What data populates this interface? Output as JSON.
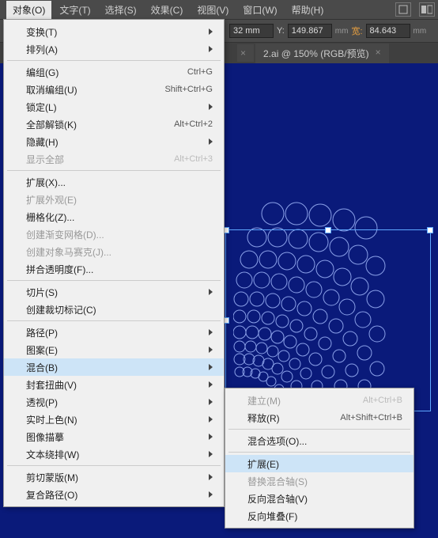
{
  "menubar": {
    "items": [
      {
        "label": "对象(O)"
      },
      {
        "label": "文字(T)"
      },
      {
        "label": "选择(S)"
      },
      {
        "label": "效果(C)"
      },
      {
        "label": "视图(V)"
      },
      {
        "label": "窗口(W)"
      },
      {
        "label": "帮助(H)"
      }
    ]
  },
  "options": {
    "x_unit": "32 mm",
    "y_label": "Y:",
    "y_value": "149.867",
    "w_label": "宽:",
    "w_value": "84.643",
    "unit": "mm"
  },
  "tabs": {
    "visible": {
      "label": "2.ai @ 150% (RGB/预览)",
      "close": "×"
    },
    "partial_close": "×"
  },
  "menu": {
    "transform": "变换(T)",
    "arrange": "排列(A)",
    "group": "编组(G)",
    "group_sc": "Ctrl+G",
    "ungroup": "取消编组(U)",
    "ungroup_sc": "Shift+Ctrl+G",
    "lock": "锁定(L)",
    "unlock_all": "全部解锁(K)",
    "unlock_all_sc": "Alt+Ctrl+2",
    "hide": "隐藏(H)",
    "show_all": "显示全部",
    "show_all_sc": "Alt+Ctrl+3",
    "expand": "扩展(X)...",
    "expand_appearance": "扩展外观(E)",
    "rasterize": "栅格化(Z)...",
    "gradient_mesh": "创建渐变网格(D)...",
    "mosaic": "创建对象马赛克(J)...",
    "flatten": "拼合透明度(F)...",
    "slice": "切片(S)",
    "trim_marks": "创建裁切标记(C)",
    "path": "路径(P)",
    "pattern": "图案(E)",
    "blend": "混合(B)",
    "envelope": "封套扭曲(V)",
    "perspective": "透视(P)",
    "live_paint": "实时上色(N)",
    "image_trace": "图像描摹",
    "text_wrap": "文本绕排(W)",
    "clipping_mask": "剪切蒙版(M)",
    "compound_path": "复合路径(O)"
  },
  "submenu": {
    "make": "建立(M)",
    "make_sc": "Alt+Ctrl+B",
    "release": "释放(R)",
    "release_sc": "Alt+Shift+Ctrl+B",
    "blend_options": "混合选项(O)...",
    "expand": "扩展(E)",
    "replace_spine": "替换混合轴(S)",
    "reverse_spine": "反向混合轴(V)",
    "reverse_front": "反向堆叠(F)"
  }
}
